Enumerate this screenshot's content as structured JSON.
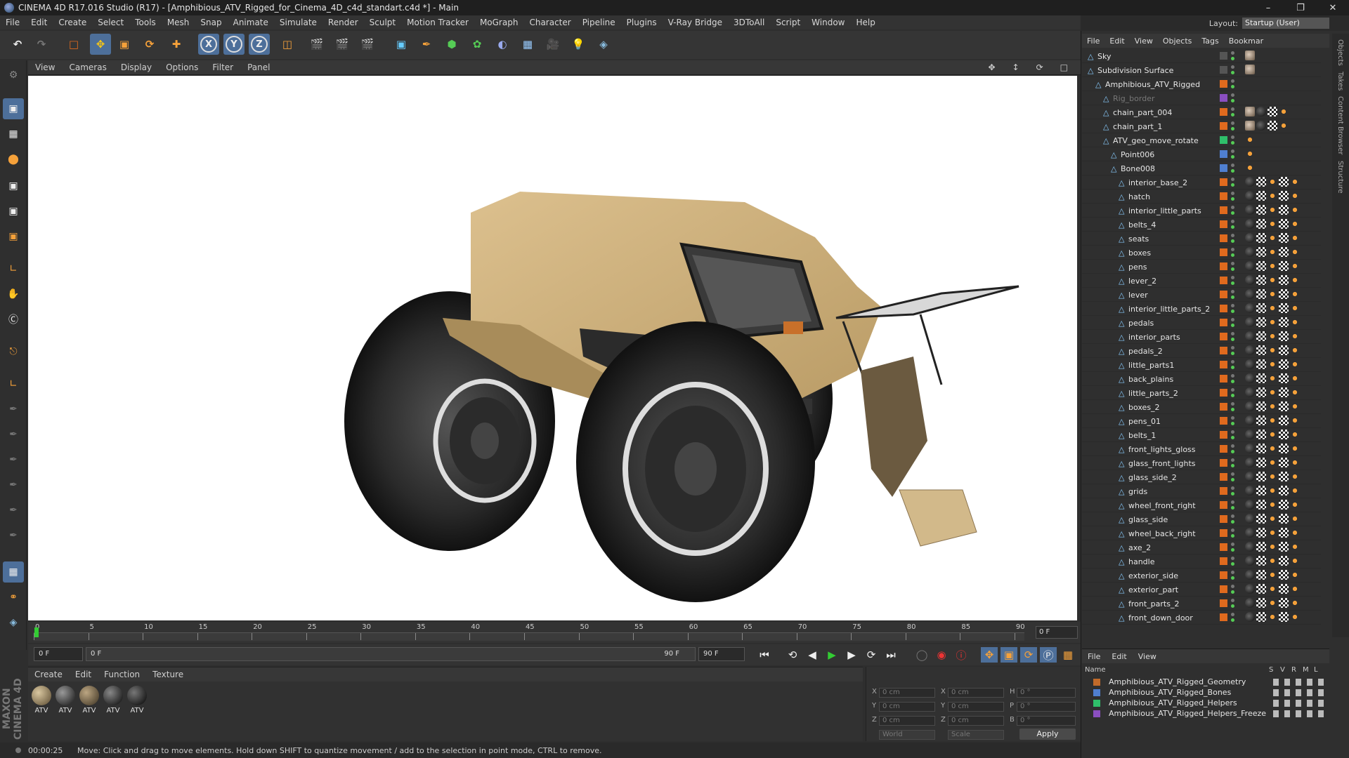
{
  "window": {
    "title": "CINEMA 4D R17.016 Studio (R17) - [Amphibious_ATV_Rigged_for_Cinema_4D_c4d_standart.c4d *] - Main"
  },
  "menu": [
    "File",
    "Edit",
    "Create",
    "Select",
    "Tools",
    "Mesh",
    "Snap",
    "Animate",
    "Simulate",
    "Render",
    "Sculpt",
    "Motion Tracker",
    "MoGraph",
    "Character",
    "Pipeline",
    "Plugins",
    "V-Ray Bridge",
    "3DToAll",
    "Script",
    "Window",
    "Help"
  ],
  "toolbar": {
    "axis_x": "X",
    "axis_y": "Y",
    "axis_z": "Z"
  },
  "layout": {
    "label": "Layout:",
    "value": "Startup (User)"
  },
  "viewport_menu": [
    "View",
    "Cameras",
    "Display",
    "Options",
    "Filter",
    "Panel"
  ],
  "timeline": {
    "ticks": [
      "0",
      "5",
      "10",
      "15",
      "20",
      "25",
      "30",
      "35",
      "40",
      "45",
      "50",
      "55",
      "60",
      "65",
      "70",
      "75",
      "80",
      "85",
      "90"
    ],
    "current_frame": "0 F"
  },
  "transport": {
    "start": "0 F",
    "slider_start": "0 F",
    "slider_end": "90 F",
    "end": "90 F"
  },
  "materials": {
    "menu": [
      "Create",
      "Edit",
      "Function",
      "Texture"
    ],
    "items": [
      "ATV",
      "ATV",
      "ATV",
      "ATV",
      "ATV"
    ]
  },
  "coords": {
    "labels": {
      "x": "X",
      "y": "Y",
      "z": "Z",
      "x2": "X",
      "y2": "Y",
      "z2": "Z",
      "h": "H",
      "p": "P",
      "b": "B"
    },
    "pos": [
      "0 cm",
      "0 cm",
      "0 cm"
    ],
    "size": [
      "0 cm",
      "0 cm",
      "0 cm"
    ],
    "rot": [
      "0 °",
      "0 °",
      "0 °"
    ],
    "mode_world": "World",
    "mode_scale": "Scale",
    "apply": "Apply"
  },
  "status": {
    "time": "00:00:25",
    "message": "Move: Click and drag to move elements. Hold down SHIFT to quantize movement / add to the selection in point mode, CTRL to remove."
  },
  "object_manager": {
    "menu": [
      "File",
      "Edit",
      "View",
      "Objects",
      "Tags",
      "Bookmar"
    ],
    "objects": [
      {
        "name": "Sky",
        "indent": 0
      },
      {
        "name": "Subdivision Surface",
        "indent": 0
      },
      {
        "name": "Amphibious_ATV_Rigged",
        "indent": 1
      },
      {
        "name": "Rig_border",
        "indent": 2
      },
      {
        "name": "chain_part_004",
        "indent": 2
      },
      {
        "name": "chain_part_1",
        "indent": 2
      },
      {
        "name": "ATV_geo_move_rotate",
        "indent": 2
      },
      {
        "name": "Point006",
        "indent": 3
      },
      {
        "name": "Bone008",
        "indent": 3
      },
      {
        "name": "interior_base_2",
        "indent": 4
      },
      {
        "name": "hatch",
        "indent": 4
      },
      {
        "name": "interior_little_parts",
        "indent": 4
      },
      {
        "name": "belts_4",
        "indent": 4
      },
      {
        "name": "seats",
        "indent": 4
      },
      {
        "name": "boxes",
        "indent": 4
      },
      {
        "name": "pens",
        "indent": 4
      },
      {
        "name": "lever_2",
        "indent": 4
      },
      {
        "name": "lever",
        "indent": 4
      },
      {
        "name": "interior_little_parts_2",
        "indent": 4
      },
      {
        "name": "pedals",
        "indent": 4
      },
      {
        "name": "interior_parts",
        "indent": 4
      },
      {
        "name": "pedals_2",
        "indent": 4
      },
      {
        "name": "little_parts1",
        "indent": 4
      },
      {
        "name": "back_plains",
        "indent": 4
      },
      {
        "name": "little_parts_2",
        "indent": 4
      },
      {
        "name": "boxes_2",
        "indent": 4
      },
      {
        "name": "pens_01",
        "indent": 4
      },
      {
        "name": "belts_1",
        "indent": 4
      },
      {
        "name": "front_lights_gloss",
        "indent": 4
      },
      {
        "name": "glass_front_lights",
        "indent": 4
      },
      {
        "name": "glass_side_2",
        "indent": 4
      },
      {
        "name": "grids",
        "indent": 4
      },
      {
        "name": "wheel_front_right",
        "indent": 4
      },
      {
        "name": "glass_side",
        "indent": 4
      },
      {
        "name": "wheel_back_right",
        "indent": 4
      },
      {
        "name": "axe_2",
        "indent": 4
      },
      {
        "name": "handle",
        "indent": 4
      },
      {
        "name": "exterior_side",
        "indent": 4
      },
      {
        "name": "exterior_part",
        "indent": 4
      },
      {
        "name": "front_parts_2",
        "indent": 4
      },
      {
        "name": "front_down_door",
        "indent": 4
      }
    ]
  },
  "side_tabs": [
    "Objects",
    "Takes",
    "Content Browser",
    "Structure"
  ],
  "layers": {
    "menu": [
      "File",
      "Edit",
      "View"
    ],
    "header": {
      "name": "Name",
      "s": "S",
      "v": "V",
      "r": "R",
      "m": "M",
      "l": "L"
    },
    "items": [
      {
        "name": "Amphibious_ATV_Rigged_Geometry",
        "color": "#c06a2a"
      },
      {
        "name": "Amphibious_ATV_Rigged_Bones",
        "color": "#4f7fd0"
      },
      {
        "name": "Amphibious_ATV_Rigged_Helpers",
        "color": "#2fbf6a"
      },
      {
        "name": "Amphibious_ATV_Rigged_Helpers_Freeze",
        "color": "#8a4fc0"
      }
    ]
  },
  "logo": "MAXON CINEMA 4D"
}
